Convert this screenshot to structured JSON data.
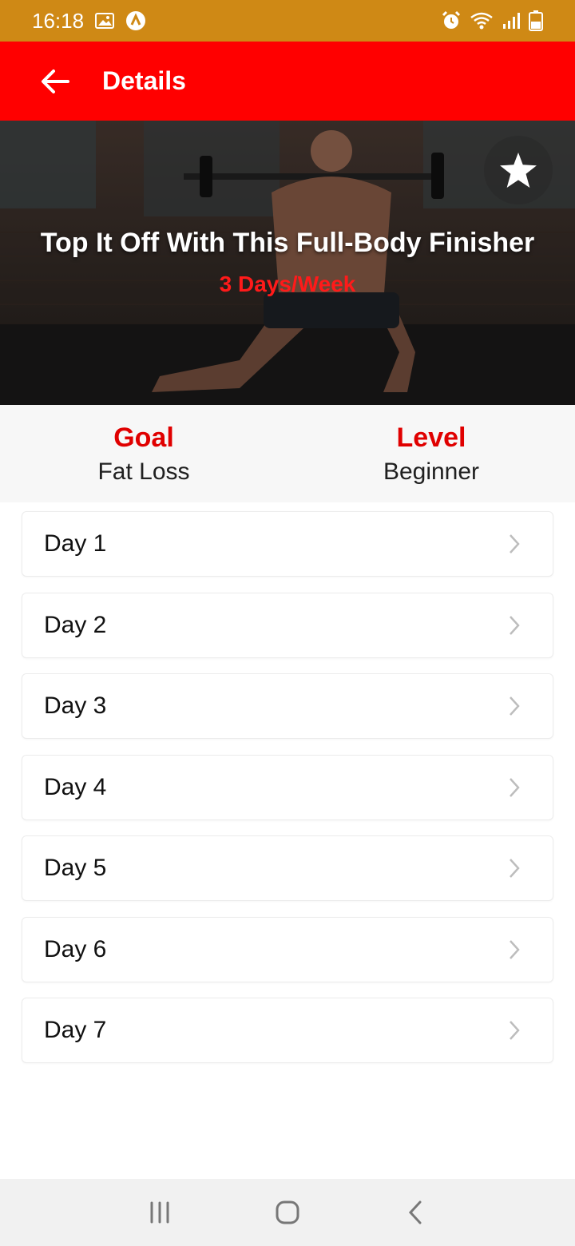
{
  "status_bar": {
    "time": "16:18",
    "icons_left": [
      "image-icon",
      "app-notification-icon"
    ],
    "icons_right": [
      "alarm-icon",
      "wifi-icon",
      "signal-icon",
      "battery-icon"
    ],
    "color": "#CF8915"
  },
  "app_bar": {
    "title": "Details",
    "back_icon": "arrow-back-icon",
    "color": "#FF0000"
  },
  "hero": {
    "title": "Top It Off With This Full-Body Finisher",
    "subtitle": "3 Days/Week",
    "favorite_icon": "star-icon"
  },
  "info": {
    "goal_label": "Goal",
    "goal_value": "Fat Loss",
    "level_label": "Level",
    "level_value": "Beginner",
    "accent_color": "#E00000"
  },
  "days": [
    {
      "label": "Day 1"
    },
    {
      "label": "Day 2"
    },
    {
      "label": "Day 3"
    },
    {
      "label": "Day 4"
    },
    {
      "label": "Day 5"
    },
    {
      "label": "Day 6"
    },
    {
      "label": "Day 7"
    }
  ],
  "nav_bar": {
    "buttons": [
      "recent-apps-icon",
      "home-icon",
      "back-icon"
    ]
  }
}
